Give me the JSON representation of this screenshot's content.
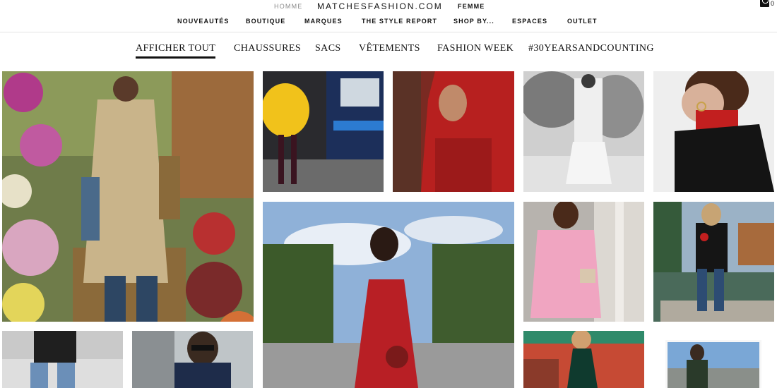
{
  "header": {
    "gender_men": "HOMME",
    "logo": "MATCHESFASHION.COM",
    "gender_women": "FEMME",
    "cart_count": "0"
  },
  "main_nav": [
    "NOUVEAUTÉS",
    "BOUTIQUE",
    "MARQUES",
    "THE STYLE REPORT",
    "SHOP BY...",
    "ESPACES",
    "OUTLET"
  ],
  "sub_nav": [
    "AFFICHER TOUT",
    "CHAUSSURES",
    "SACS",
    "VÊTEMENTS",
    "FASHION WEEK",
    "#30YEARSANDCOUNTING"
  ],
  "active_sub_nav": "AFFICHER TOUT",
  "colors": {
    "text": "#111111",
    "muted": "#8a8a8a",
    "divider": "#e2e2e2"
  },
  "icons": [
    "shopping-bag-icon"
  ]
}
